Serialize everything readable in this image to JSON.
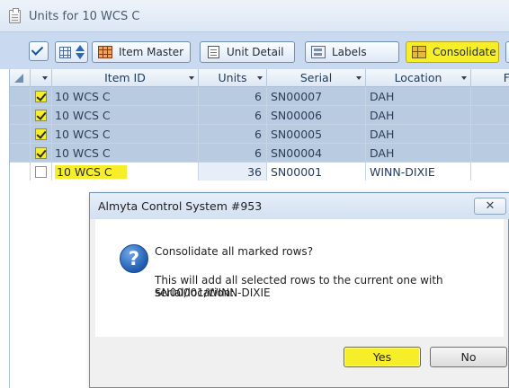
{
  "window": {
    "title": "Units for 10 WCS C"
  },
  "toolbar": {
    "item_master": "Item Master",
    "unit_detail": "Unit Detail",
    "labels": "Labels",
    "consolidate": "Consolidate"
  },
  "grid": {
    "columns": [
      "Item ID",
      "Units",
      "Serial",
      "Location",
      "F"
    ],
    "rows": [
      {
        "checked": true,
        "item_id": "10 WCS C",
        "units": "6",
        "serial": "SN00007",
        "location": "DAH"
      },
      {
        "checked": true,
        "item_id": "10 WCS C",
        "units": "6",
        "serial": "SN00006",
        "location": "DAH"
      },
      {
        "checked": true,
        "item_id": "10 WCS C",
        "units": "6",
        "serial": "SN00005",
        "location": "DAH"
      },
      {
        "checked": true,
        "item_id": "10 WCS C",
        "units": "6",
        "serial": "SN00004",
        "location": "DAH"
      },
      {
        "checked": false,
        "item_id": "10 WCS C",
        "units": "36",
        "serial": "SN00001",
        "location": "WINN-DIXIE"
      }
    ]
  },
  "dialog": {
    "title": "Almyta Control System #953",
    "close": "✕",
    "question": "Consolidate all marked rows?",
    "detail_line1": "This will add all selected rows to the current one with serial/location:",
    "detail_line2": "SN00001/WINN-DIXIE",
    "yes": "Yes",
    "no": "No"
  },
  "colors": {
    "highlight": "#f7ee2a",
    "selected_row": "#b9cbe0",
    "toolbar": "#c9daf0"
  }
}
